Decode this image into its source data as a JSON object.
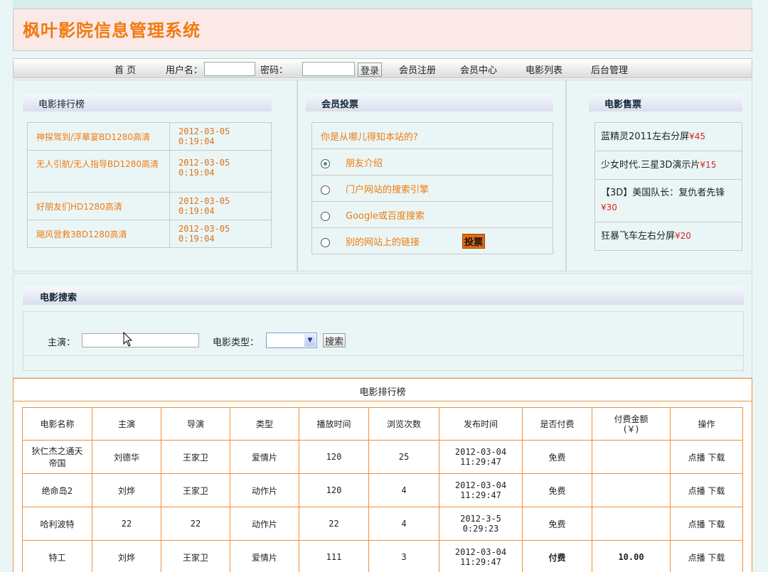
{
  "app_title": "枫叶影院信息管理系统",
  "nav": {
    "home": "首 页",
    "username_label": "用户名：",
    "password_label": "密码：",
    "login_button": "登录",
    "register": "会员注册",
    "member_center": "会员中心",
    "movie_list": "电影列表",
    "admin": "后台管理"
  },
  "ranking": {
    "title": "电影排行榜",
    "items": [
      {
        "name": "神探驾到/浮華宴BD1280高清",
        "time": "2012-03-05 0:19:04"
      },
      {
        "name": "无人引航/无人指导BD1280高清",
        "time": "2012-03-05 0:19:04"
      },
      {
        "name": "好朋友们HD1280高清",
        "time": "2012-03-05 0:19:04"
      },
      {
        "name": "飓风营救3BD1280高清",
        "time": "2012-03-05 0:19:04"
      }
    ]
  },
  "vote": {
    "title": "会员投票",
    "question": "你是从哪儿得知本站的?",
    "options": [
      "朋友介绍",
      "门户网站的搜索引擎",
      "Google或百度搜索",
      "别的网站上的链接"
    ],
    "selected_index": 0,
    "button": "投票"
  },
  "sales": {
    "title": "电影售票",
    "items": [
      {
        "name": "蓝精灵2011左右分屏",
        "price": "¥45"
      },
      {
        "name": "少女时代.三星3D演示片",
        "price": "¥15"
      },
      {
        "name": "【3D】美国队长：复仇者先锋",
        "price": "¥30"
      },
      {
        "name": "狂暴飞车左右分屏",
        "price": "¥20"
      }
    ]
  },
  "search": {
    "title": "电影搜索",
    "actor_label": "主演：",
    "type_label": "电影类型：",
    "button": "搜索"
  },
  "film_list": {
    "title": "电影排行榜",
    "headers": [
      "电影名称",
      "主演",
      "导演",
      "类型",
      "播放时间",
      "浏览次数",
      "发布时间",
      "是否付费",
      "付费金额\n(￥)",
      "操作"
    ],
    "rows": [
      {
        "name": "狄仁杰之通天帝国",
        "actor": "刘德华",
        "director": "王家卫",
        "type": "爱情片",
        "duration": "120",
        "views": "25",
        "date": "2012-03-04",
        "clock": "11:29:47",
        "paid": "免费",
        "amount": "",
        "play": "点播",
        "download": "下载"
      },
      {
        "name": "绝命岛2",
        "actor": "刘烨",
        "director": "王家卫",
        "type": "动作片",
        "duration": "120",
        "views": "4",
        "date": "2012-03-04",
        "clock": "11:29:47",
        "paid": "免费",
        "amount": "",
        "play": "点播",
        "download": "下载"
      },
      {
        "name": "哈利波特",
        "actor": "22",
        "director": "22",
        "type": "动作片",
        "duration": "22",
        "views": "4",
        "date": "2012-3-5",
        "clock": "0:29:23",
        "paid": "免费",
        "amount": "",
        "play": "点播",
        "download": "下载"
      },
      {
        "name": "特工",
        "actor": "刘烨",
        "director": "王家卫",
        "type": "爱情片",
        "duration": "111",
        "views": "3",
        "date": "2012-03-04",
        "clock": "11:29:47",
        "paid": "付费",
        "amount": "10.00",
        "play": "点播",
        "download": "下载"
      }
    ]
  }
}
